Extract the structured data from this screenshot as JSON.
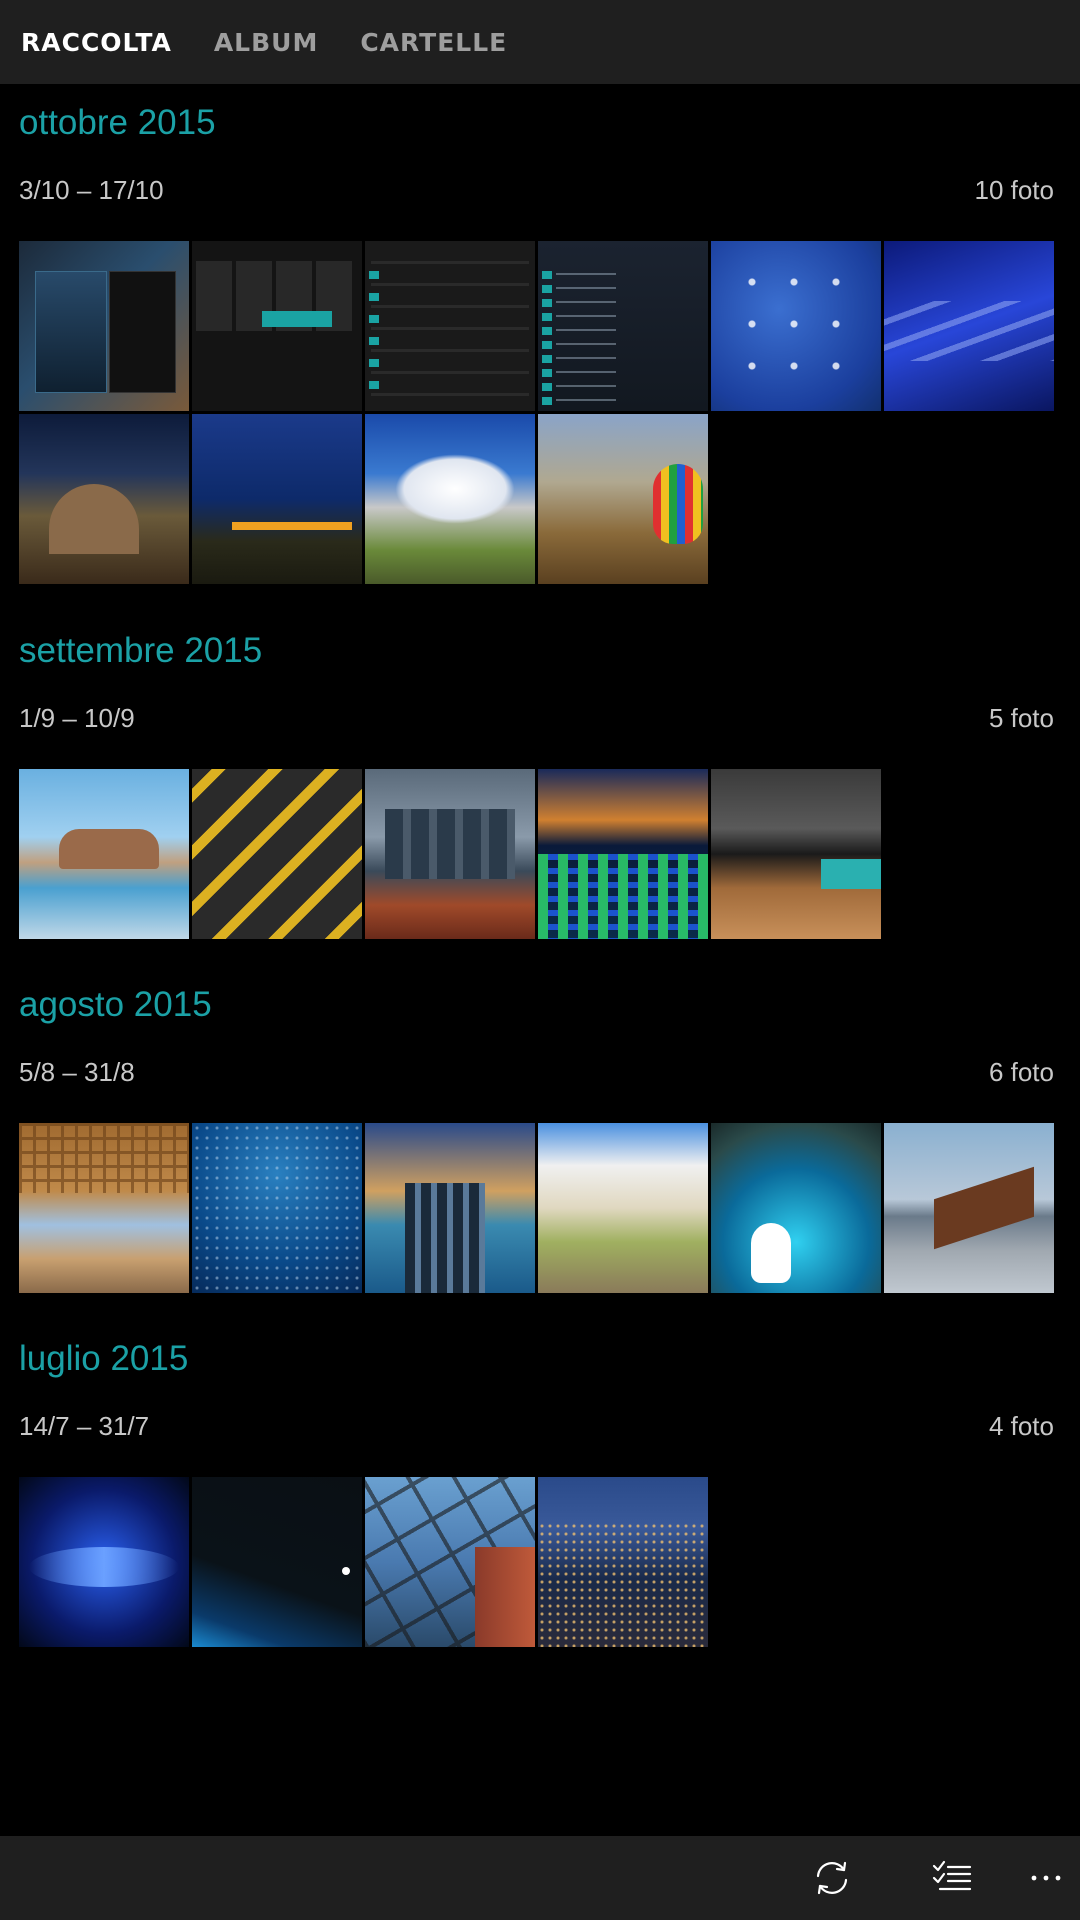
{
  "pivot": {
    "tabs": [
      {
        "label": "RACCOLTA",
        "active": true
      },
      {
        "label": "ALBUM",
        "active": false
      },
      {
        "label": "CARTELLE",
        "active": false
      }
    ]
  },
  "sections": [
    {
      "month": "ottobre 2015",
      "range": "3/10 – 17/10",
      "count": "10 foto"
    },
    {
      "month": "settembre 2015",
      "range": "1/9 – 10/9",
      "count": "5 foto"
    },
    {
      "month": "agosto 2015",
      "range": "5/8 – 31/8",
      "count": "6 foto"
    },
    {
      "month": "luglio 2015",
      "range": "14/7 – 31/7",
      "count": "4 foto"
    }
  ],
  "appbar": {
    "buttons": [
      {
        "icon": "sync-icon"
      },
      {
        "icon": "select-icon"
      },
      {
        "icon": "more-icon"
      }
    ]
  },
  "colors": {
    "accent": "#1ba1a6",
    "background": "#000000",
    "bar": "#1f1f1f",
    "secondary_text": "#c8c8c8",
    "inactive_tab": "#9e9e9e"
  }
}
